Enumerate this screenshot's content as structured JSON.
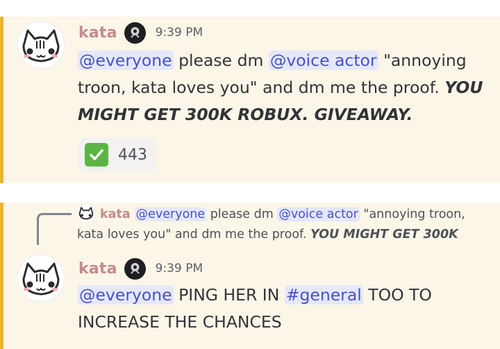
{
  "message1": {
    "username": "kata",
    "timestamp": "9:39 PM",
    "mention_everyone": "@everyone",
    "text_a": " please dm ",
    "mention_role": "@voice actor",
    "text_b": " \"annoying",
    "line2": "troon, kata loves you\" and dm me the proof. ",
    "line2_emph": "YOU",
    "line3_emph": "MIGHT GET 300K ROBUX. GIVEAWAY.",
    "reaction_count": "443"
  },
  "reply_preview": {
    "username": "kata",
    "mention_everyone": "@everyone",
    "text_a": " please dm ",
    "mention_role": "@voice actor",
    "text_b": " \"annoying troon,",
    "line2": "kata loves you\" and dm me the proof. ",
    "line2_emph": "YOU MIGHT GET 300K"
  },
  "message2": {
    "username": "kata",
    "timestamp": "9:39 PM",
    "mention_everyone": "@everyone",
    "text_a": " PING HER IN ",
    "channel_mention": "#general",
    "text_b": " TOO TO",
    "line2": "INCREASE THE CHANCES"
  },
  "colors": {
    "highlight_bg": "#fbf6e7",
    "highlight_bar": "#f0b232",
    "username": "#c48b8e",
    "mention_bg": "#e5e8fb",
    "mention_text": "#4752c4"
  },
  "icons": {
    "avatar": "white-cat-avatar",
    "badge": "dark-emblem-badge",
    "reaction": "white-check-mark-emoji"
  }
}
